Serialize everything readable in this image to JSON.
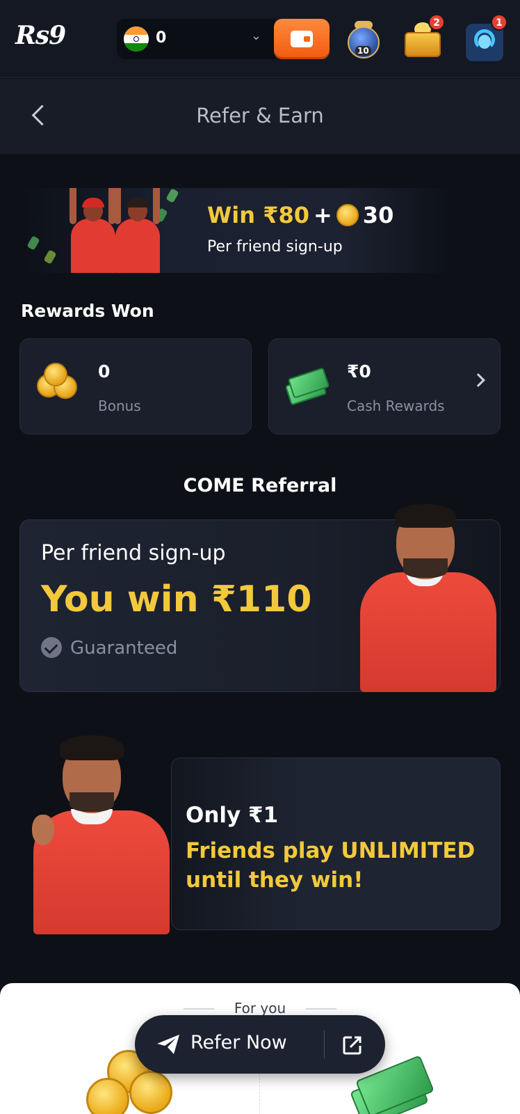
{
  "topbar": {
    "logo": "Rs9",
    "balance": "0",
    "jar_count": "10",
    "chest_badge": "2",
    "support_badge": "1"
  },
  "header": {
    "title": "Refer & Earn"
  },
  "banner": {
    "amount": "Win ₹80",
    "plus": "+",
    "coins": "30",
    "subtitle": "Per friend sign-up"
  },
  "rewards": {
    "heading": "Rewards Won",
    "bonus_value": "0",
    "bonus_label": "Bonus",
    "cash_value": "₹0",
    "cash_label": "Cash Rewards"
  },
  "referral": {
    "heading": "COME Referral",
    "card1_subtitle": "Per friend sign-up",
    "card1_headline": "You win ₹110",
    "card1_guarantee": "Guaranteed",
    "card2_line1": "Only ₹1",
    "card2_line2": "Friends play UNLIMITED until they win!"
  },
  "bottom_sheet": {
    "for_you": "For you"
  },
  "refer_bar": {
    "label": "Refer Now"
  },
  "colors": {
    "background": "#0d1017",
    "gold": "#f3c93c",
    "accent_orange": "#f05a10",
    "badge_red": "#e8402f"
  }
}
